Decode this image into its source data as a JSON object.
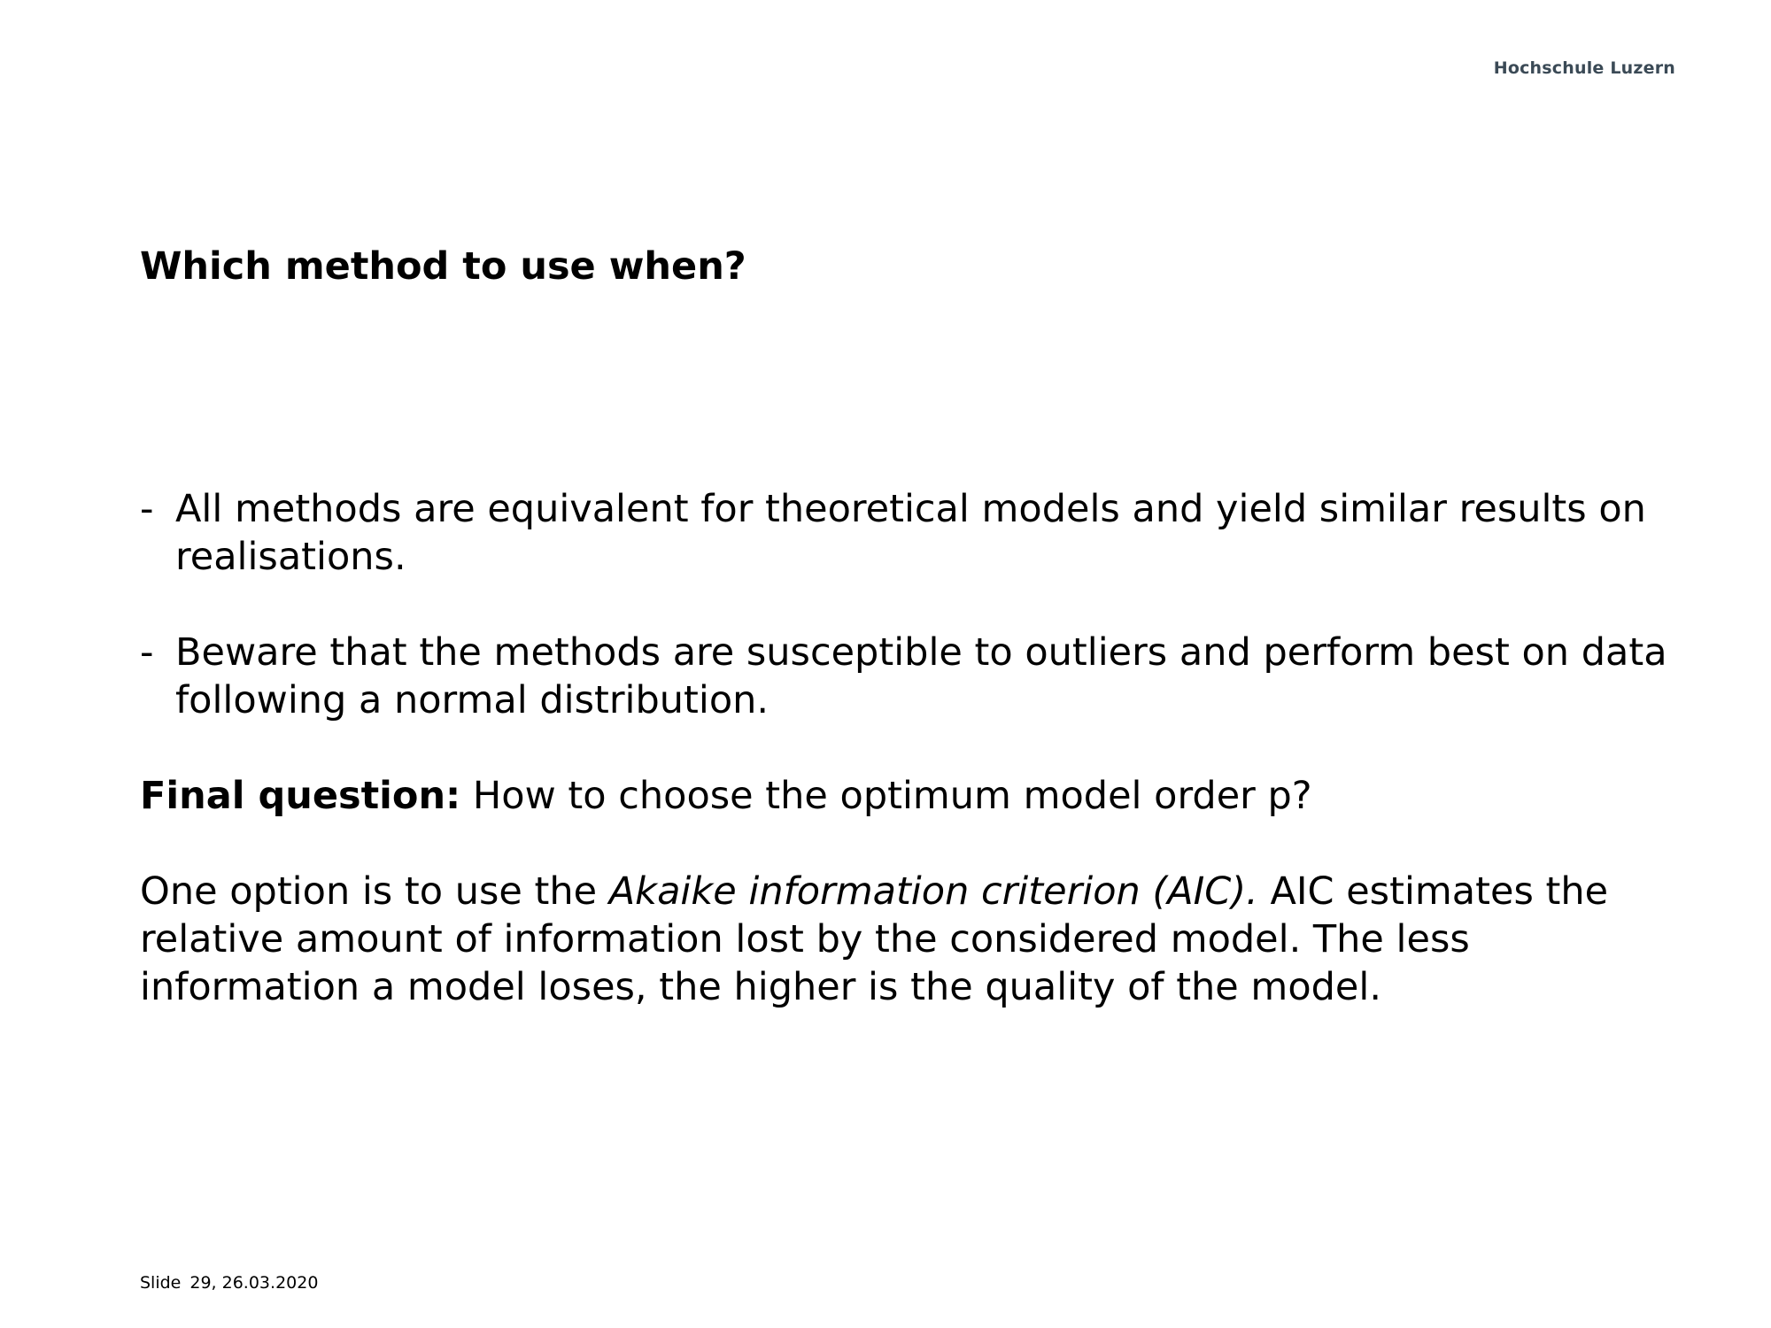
{
  "header": {
    "brand": "Hochschule Luzern"
  },
  "slide": {
    "title": "Which method to use when?",
    "bullets": [
      {
        "marker": "-",
        "text": "All methods are equivalent for theoretical models and yield similar results on realisations."
      },
      {
        "marker": "-",
        "text": "Beware that the methods are susceptible to outliers and perform best on data following a normal distribution."
      }
    ],
    "final_question": {
      "label": "Final question:",
      "text": "How to choose the optimum model order p?"
    },
    "aic_paragraph": {
      "intro": "One option is to use the",
      "term": "Akaike information criterion (AIC).",
      "text": "AIC estimates the relative amount of information lost by the considered model. The less information a model loses, the higher is the quality of the model."
    }
  },
  "footer": {
    "slide_label": "Slide",
    "slide_info": "29, 26.03.2020"
  }
}
